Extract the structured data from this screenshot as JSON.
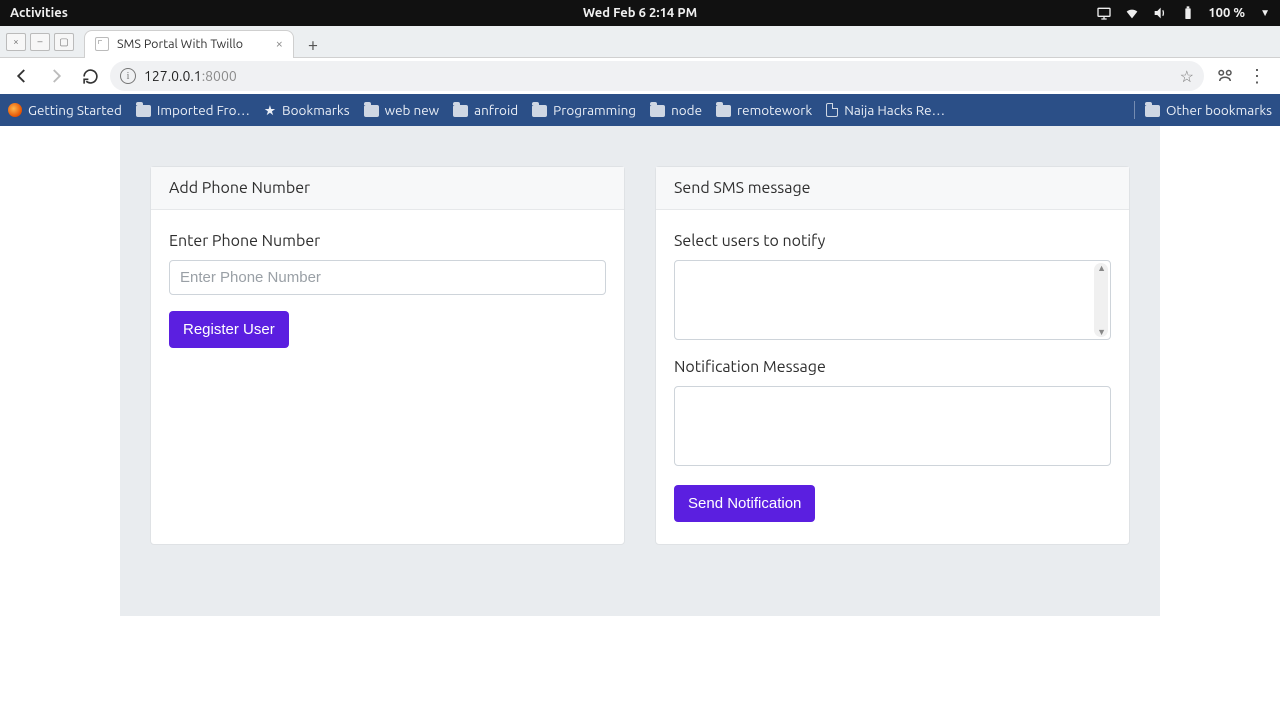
{
  "os": {
    "activities": "Activities",
    "datetime": "Wed Feb 6  2:14 PM",
    "battery": "100 %"
  },
  "tab": {
    "title": "SMS Portal With Twillo"
  },
  "url": {
    "host": "127.0.0.1",
    "port": ":8000"
  },
  "bookmarks": {
    "items": [
      "Getting Started",
      "Imported Fro…",
      "Bookmarks",
      "web new",
      "anfroid",
      "Programming",
      "node",
      "remotework",
      "Naija Hacks Re…"
    ],
    "other": "Other bookmarks"
  },
  "page": {
    "left": {
      "header": "Add Phone Number",
      "label": "Enter Phone Number",
      "placeholder": "Enter Phone Number",
      "button": "Register User"
    },
    "right": {
      "header": "Send SMS message",
      "select_label": "Select users to notify",
      "msg_label": "Notification Message",
      "button": "Send Notification"
    }
  }
}
